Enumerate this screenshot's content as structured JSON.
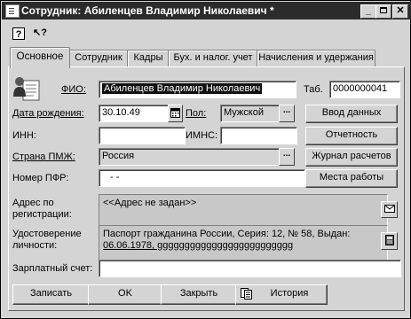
{
  "window": {
    "title": "Сотрудник: Абиленцев Владимир Николаевич *"
  },
  "toolbar": {
    "help_glyph": "?",
    "whatsthis_glyph": "↖?"
  },
  "tabs": [
    {
      "label": "Основное"
    },
    {
      "label": "Сотрудник"
    },
    {
      "label": "Кадры"
    },
    {
      "label": "Бух. и налог. учет"
    },
    {
      "label": "Начисления и удержания"
    }
  ],
  "form": {
    "fio_label": "ФИО:",
    "fio_value": "Абиленцев Владимир Николаевич",
    "tab_label": "Таб.",
    "tab_value": "0000000041",
    "birth_label": "Дата рождения:",
    "birth_value": "30.10.49",
    "sex_label": "Пол:",
    "sex_value": "Мужской",
    "inn_label": "ИНН:",
    "inn_value": "",
    "imns_label": "ИМНС:",
    "imns_value": "",
    "country_label": "Страна ПМЖ:",
    "country_value": "Россия",
    "pfr_label": "Номер ПФР:",
    "pfr_value": "-   -",
    "address_label_1": "Адрес по",
    "address_label_2": "регистрации:",
    "address_value": "<<Адрес не задан>>",
    "id_label_1": "Удостоверение",
    "id_label_2": "личности:",
    "id_value_1": "Паспорт гражданина России, Серия: 12, № 58, Выдан:",
    "id_value_2": "06.06.1978, ggggggggggggggggggggggggg",
    "account_label": "Зарплатный счет:",
    "account_value": "",
    "select_glyph": "..."
  },
  "side_buttons": {
    "data_entry": "Ввод данных",
    "reporting": "Отчетность",
    "payroll_journal": "Журнал расчетов",
    "workplaces": "Места работы"
  },
  "bottom_buttons": {
    "save": "Записать",
    "ok": "OK",
    "close": "Закрыть",
    "history": "История"
  }
}
